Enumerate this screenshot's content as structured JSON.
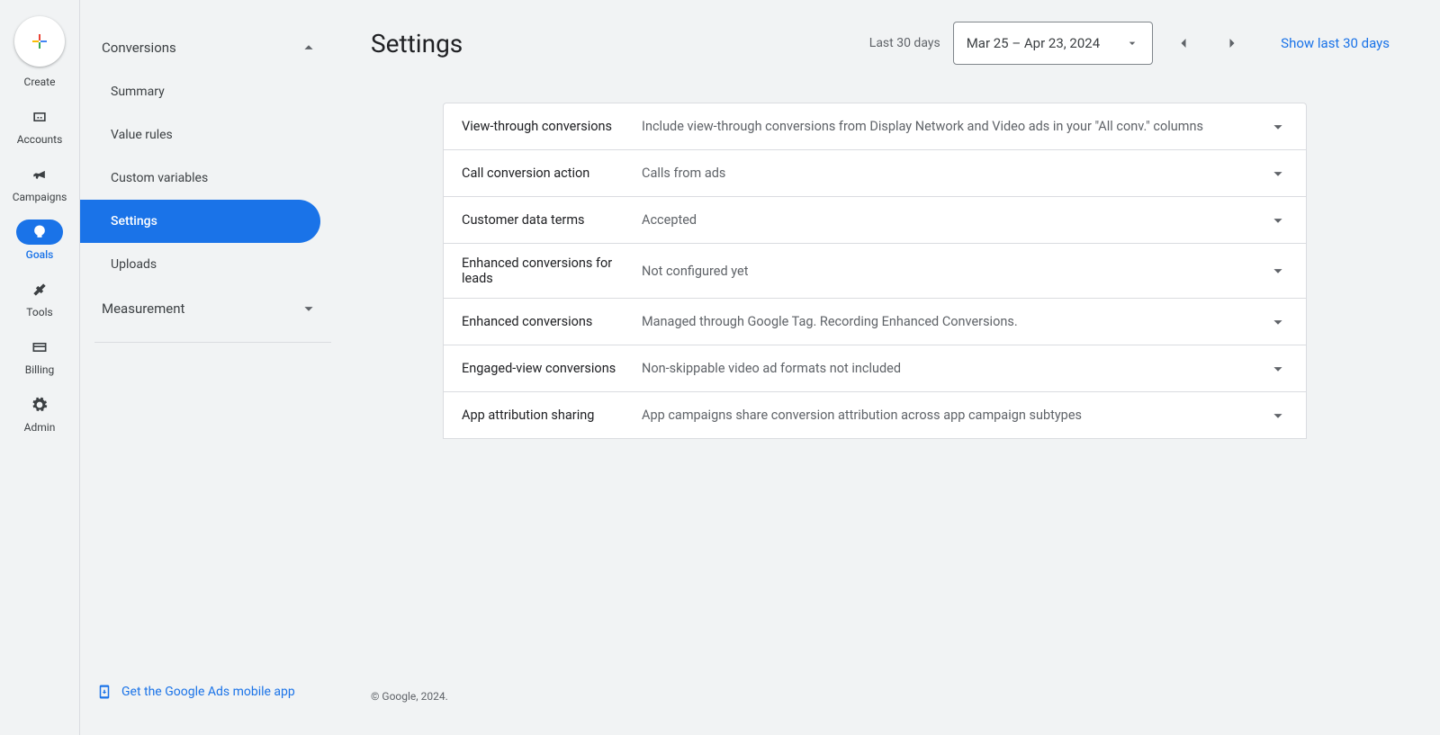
{
  "rail": {
    "create": "Create",
    "accounts": "Accounts",
    "campaigns": "Campaigns",
    "goals": "Goals",
    "tools": "Tools",
    "billing": "Billing",
    "admin": "Admin"
  },
  "sidebar": {
    "section1_label": "Conversions",
    "items": [
      "Summary",
      "Value rules",
      "Custom variables",
      "Settings",
      "Uploads"
    ],
    "section2_label": "Measurement",
    "mobile_app_link": "Get the Google Ads mobile app"
  },
  "header": {
    "title": "Settings",
    "last_label": "Last 30 days",
    "date_range": "Mar 25 – Apr 23, 2024",
    "show_last": "Show last 30 days"
  },
  "settings_rows": [
    {
      "label": "View-through conversions",
      "value": "Include view-through conversions from Display Network and Video ads in your \"All conv.\" columns"
    },
    {
      "label": "Call conversion action",
      "value": "Calls from ads"
    },
    {
      "label": "Customer data terms",
      "value": "Accepted"
    },
    {
      "label": "Enhanced conversions for leads",
      "value": "Not configured yet"
    },
    {
      "label": "Enhanced conversions",
      "value": "Managed through Google Tag. Recording Enhanced Conversions."
    },
    {
      "label": "Engaged-view conversions",
      "value": "Non-skippable video ad formats not included"
    },
    {
      "label": "App attribution sharing",
      "value": "App campaigns share conversion attribution across app campaign subtypes"
    }
  ],
  "footer": {
    "copyright": "© Google, 2024."
  }
}
